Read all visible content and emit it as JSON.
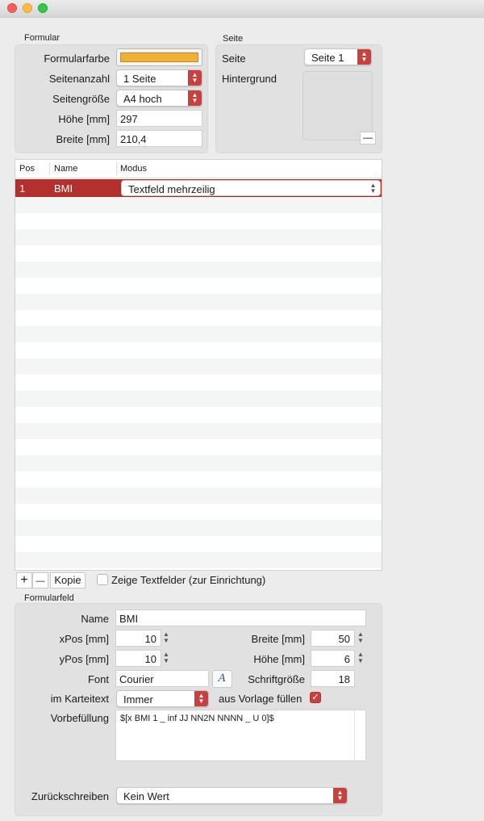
{
  "window": {
    "close_icon": "traffic-light-close",
    "minimize_icon": "traffic-light-minimize",
    "zoom_icon": "traffic-light-zoom"
  },
  "formular": {
    "title": "Formular",
    "color_label": "Formularfarbe",
    "color_value": "#f2b134",
    "page_count_label": "Seitenanzahl",
    "page_count_value": "1 Seite",
    "page_size_label": "Seitengröße",
    "page_size_value": "A4 hoch",
    "height_label": "Höhe [mm]",
    "height_value": "297",
    "width_label": "Breite [mm]",
    "width_value": "210,4"
  },
  "seite": {
    "title": "Seite",
    "page_label": "Seite",
    "page_value": "Seite 1",
    "background_label": "Hintergrund",
    "remove_icon": "minus"
  },
  "table": {
    "columns": [
      "Pos",
      "Name",
      "Modus"
    ],
    "rows": [
      {
        "pos": "1",
        "name": "BMI",
        "modus": "Textfeld mehrzeilig"
      }
    ],
    "selection_color": "#b3302e"
  },
  "toolbar": {
    "add_icon": "+",
    "remove_icon": "—",
    "copy_label": "Kopie",
    "show_fields_label": "Zeige Textfelder (zur Einrichtung)",
    "show_fields_checked": false
  },
  "formularfeld": {
    "title": "Formularfeld",
    "name_label": "Name",
    "name_value": "BMI",
    "xpos_label": "xPos [mm]",
    "xpos_value": "10",
    "ypos_label": "yPos [mm]",
    "ypos_value": "10",
    "breite_label": "Breite [mm]",
    "breite_value": "50",
    "hoehe_label": "Höhe [mm]",
    "hoehe_value": "6",
    "font_label": "Font",
    "font_value": "Courier",
    "font_button": "A",
    "fontsize_label": "Schriftgröße",
    "fontsize_value": "18",
    "karteitext_label": "im Karteitext",
    "karteitext_value": "Immer",
    "vorlage_label": "aus Vorlage füllen",
    "vorlage_checked": true,
    "vorbefuellung_label": "Vorbefüllung",
    "vorbefuellung_value": "$[x BMI 1 _ inf JJ NN2N NNNN _ U 0]$",
    "zurueck_label": "Zurückschreiben",
    "zurueck_value": "Kein Wert"
  },
  "accent_color": "#c9413f"
}
